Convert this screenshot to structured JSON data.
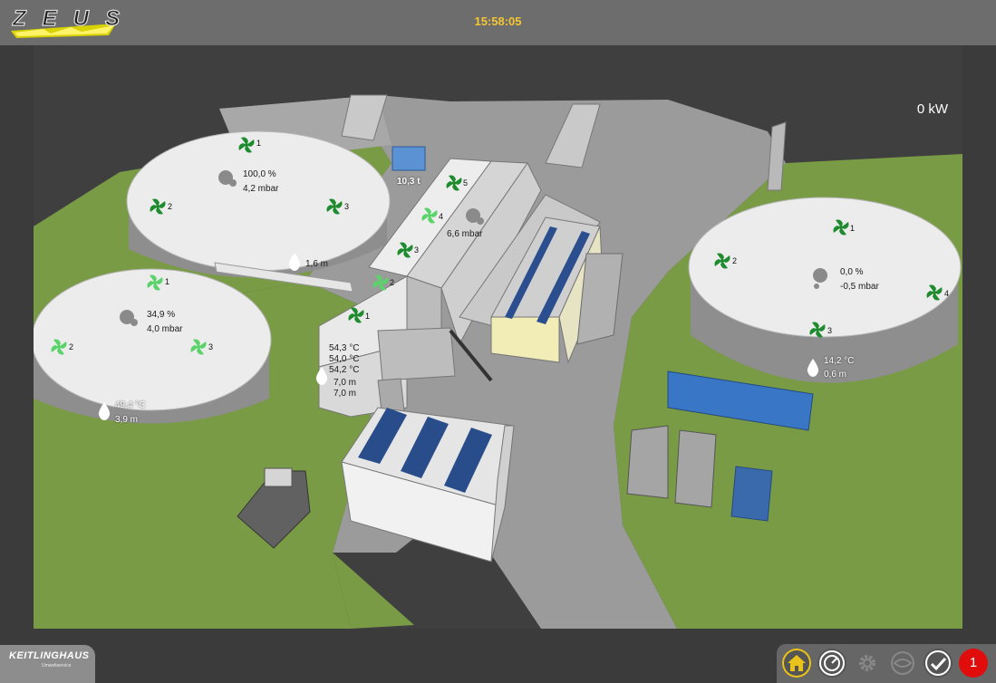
{
  "header": {
    "logo_text": "ZEUS",
    "time": "15:58:05"
  },
  "power": "0 kW",
  "tank_top_left": {
    "fans": [
      "1",
      "2",
      "3"
    ],
    "fill": "100,0 %",
    "pressure": "4,2 mbar",
    "level": "1,6 m"
  },
  "tank_bottom_left": {
    "fans": [
      "1",
      "2",
      "3"
    ],
    "fill": "34,9 %",
    "pressure": "4,0 mbar",
    "temperature": "49,4 °C",
    "level": "3,9 m"
  },
  "tank_right": {
    "fans": [
      "1",
      "2",
      "3",
      "4"
    ],
    "fill": "0,0 %",
    "pressure": "-0,5 mbar",
    "temperature": "14,2 °C",
    "level": "0,6 m"
  },
  "building": {
    "fans": [
      "1",
      "2",
      "3",
      "4",
      "5"
    ],
    "pressure": "6,6 mbar",
    "temperatures": [
      "54,3 °C",
      "54,0 °C",
      "54,2 °C"
    ],
    "levels": [
      "7,0 m",
      "7,0 m"
    ]
  },
  "scale": "10,3 t",
  "footer": {
    "brand": "KEITLINGHAUS",
    "brand_sub": "Umweltservice",
    "alarm_count": "1"
  },
  "colors": {
    "header_bg": "#6d6d6d",
    "clock": "#f3c632",
    "alarm": "#e10c0c",
    "fan_dark": "#1e8b2e",
    "fan_light": "#59d36a"
  },
  "icons": [
    "home-icon",
    "gauge-icon",
    "gear-icon",
    "eye-icon",
    "alarm-check-icon"
  ]
}
